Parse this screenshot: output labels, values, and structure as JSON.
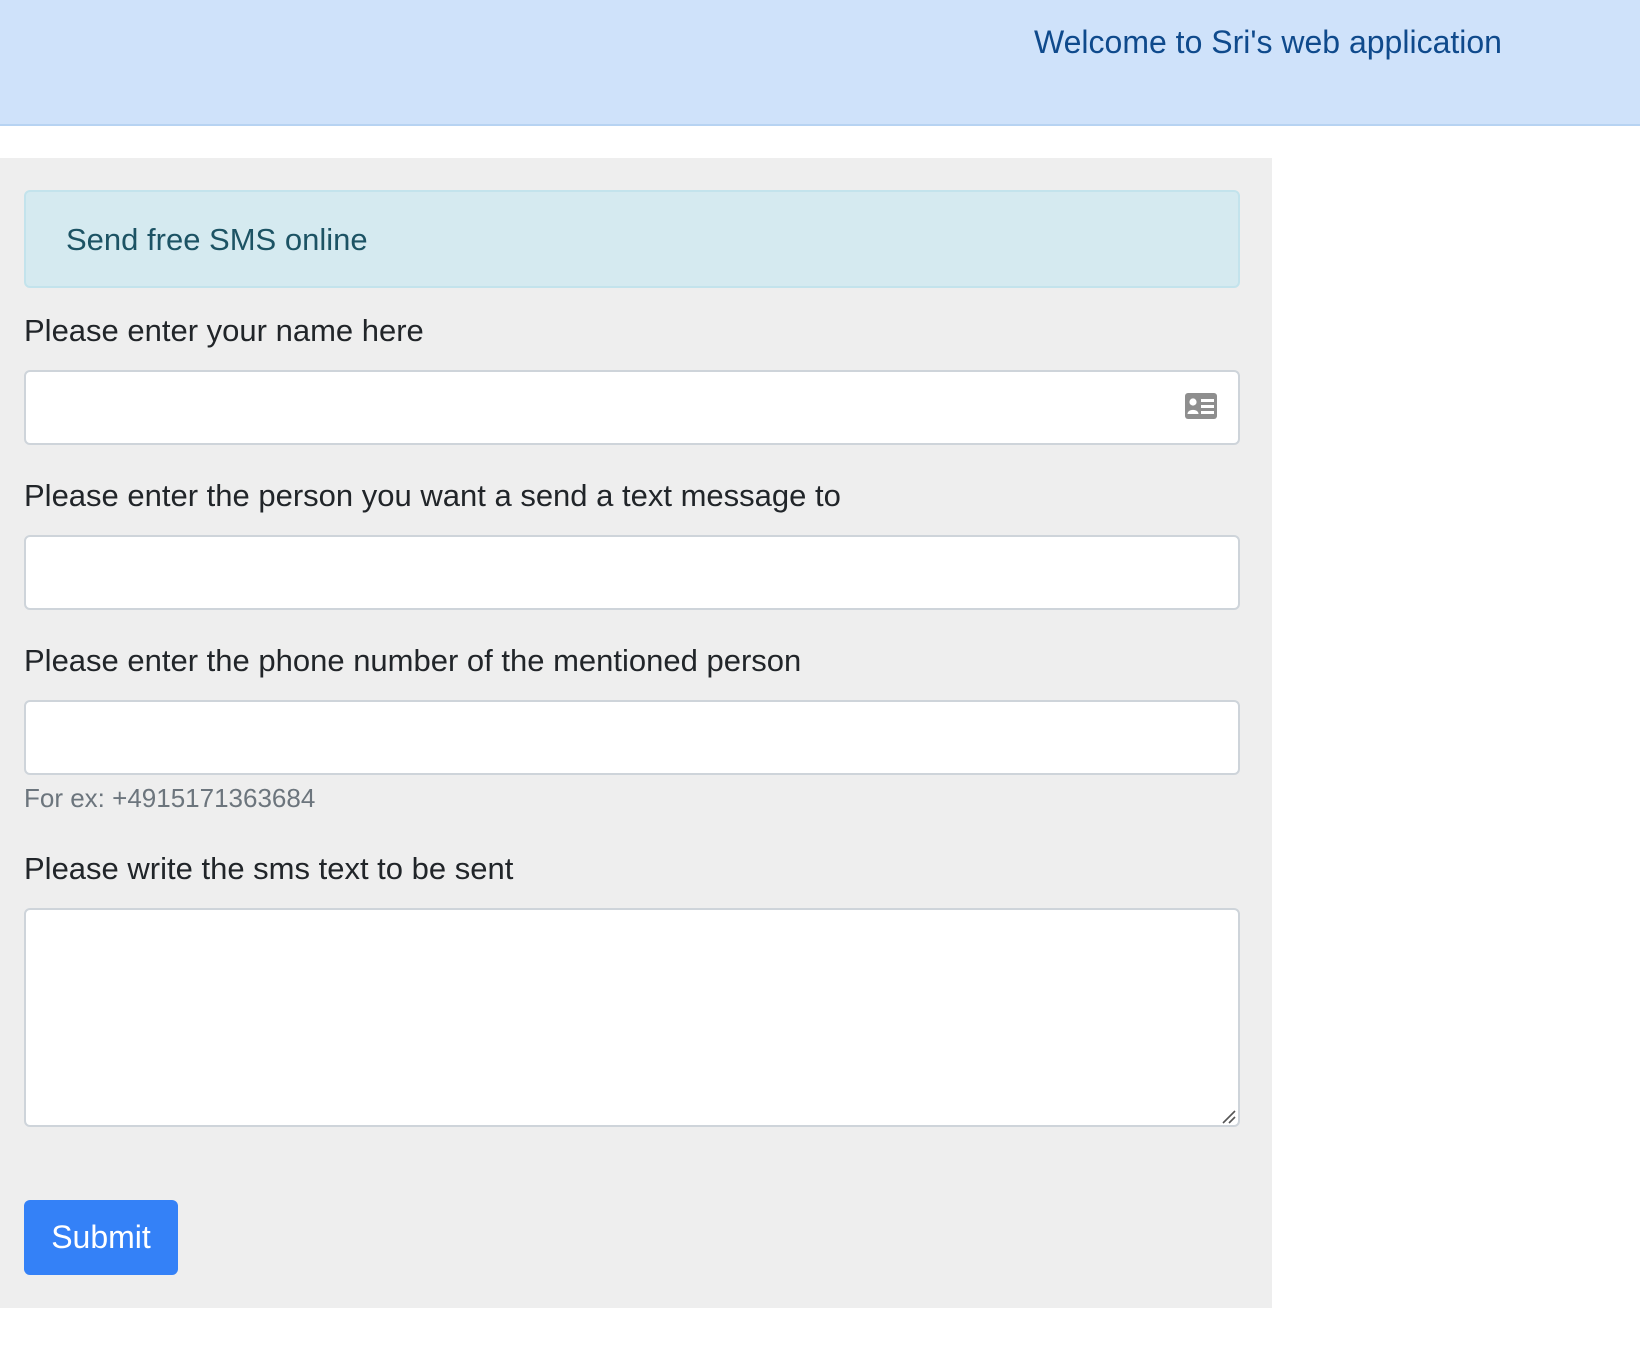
{
  "header": {
    "title": "Welcome to Sri's web application"
  },
  "form": {
    "banner": "Send free SMS online",
    "name_field": {
      "label": "Please enter your name here",
      "value": "",
      "icon": "contact-card-icon"
    },
    "recipient_field": {
      "label": "Please enter the person you want a send a text message to",
      "value": ""
    },
    "phone_field": {
      "label": "Please enter the phone number of the mentioned person",
      "value": "",
      "help": "For ex: +4915171363684"
    },
    "message_field": {
      "label": "Please write the sms text to be sent",
      "value": ""
    },
    "submit_label": "Submit"
  },
  "colors": {
    "header_bg": "#cfe2fa",
    "header_text": "#0f4a8c",
    "panel_bg": "#eeeeee",
    "alert_bg": "#d5eaf0",
    "alert_text": "#1c5364",
    "primary": "#3481f7"
  }
}
